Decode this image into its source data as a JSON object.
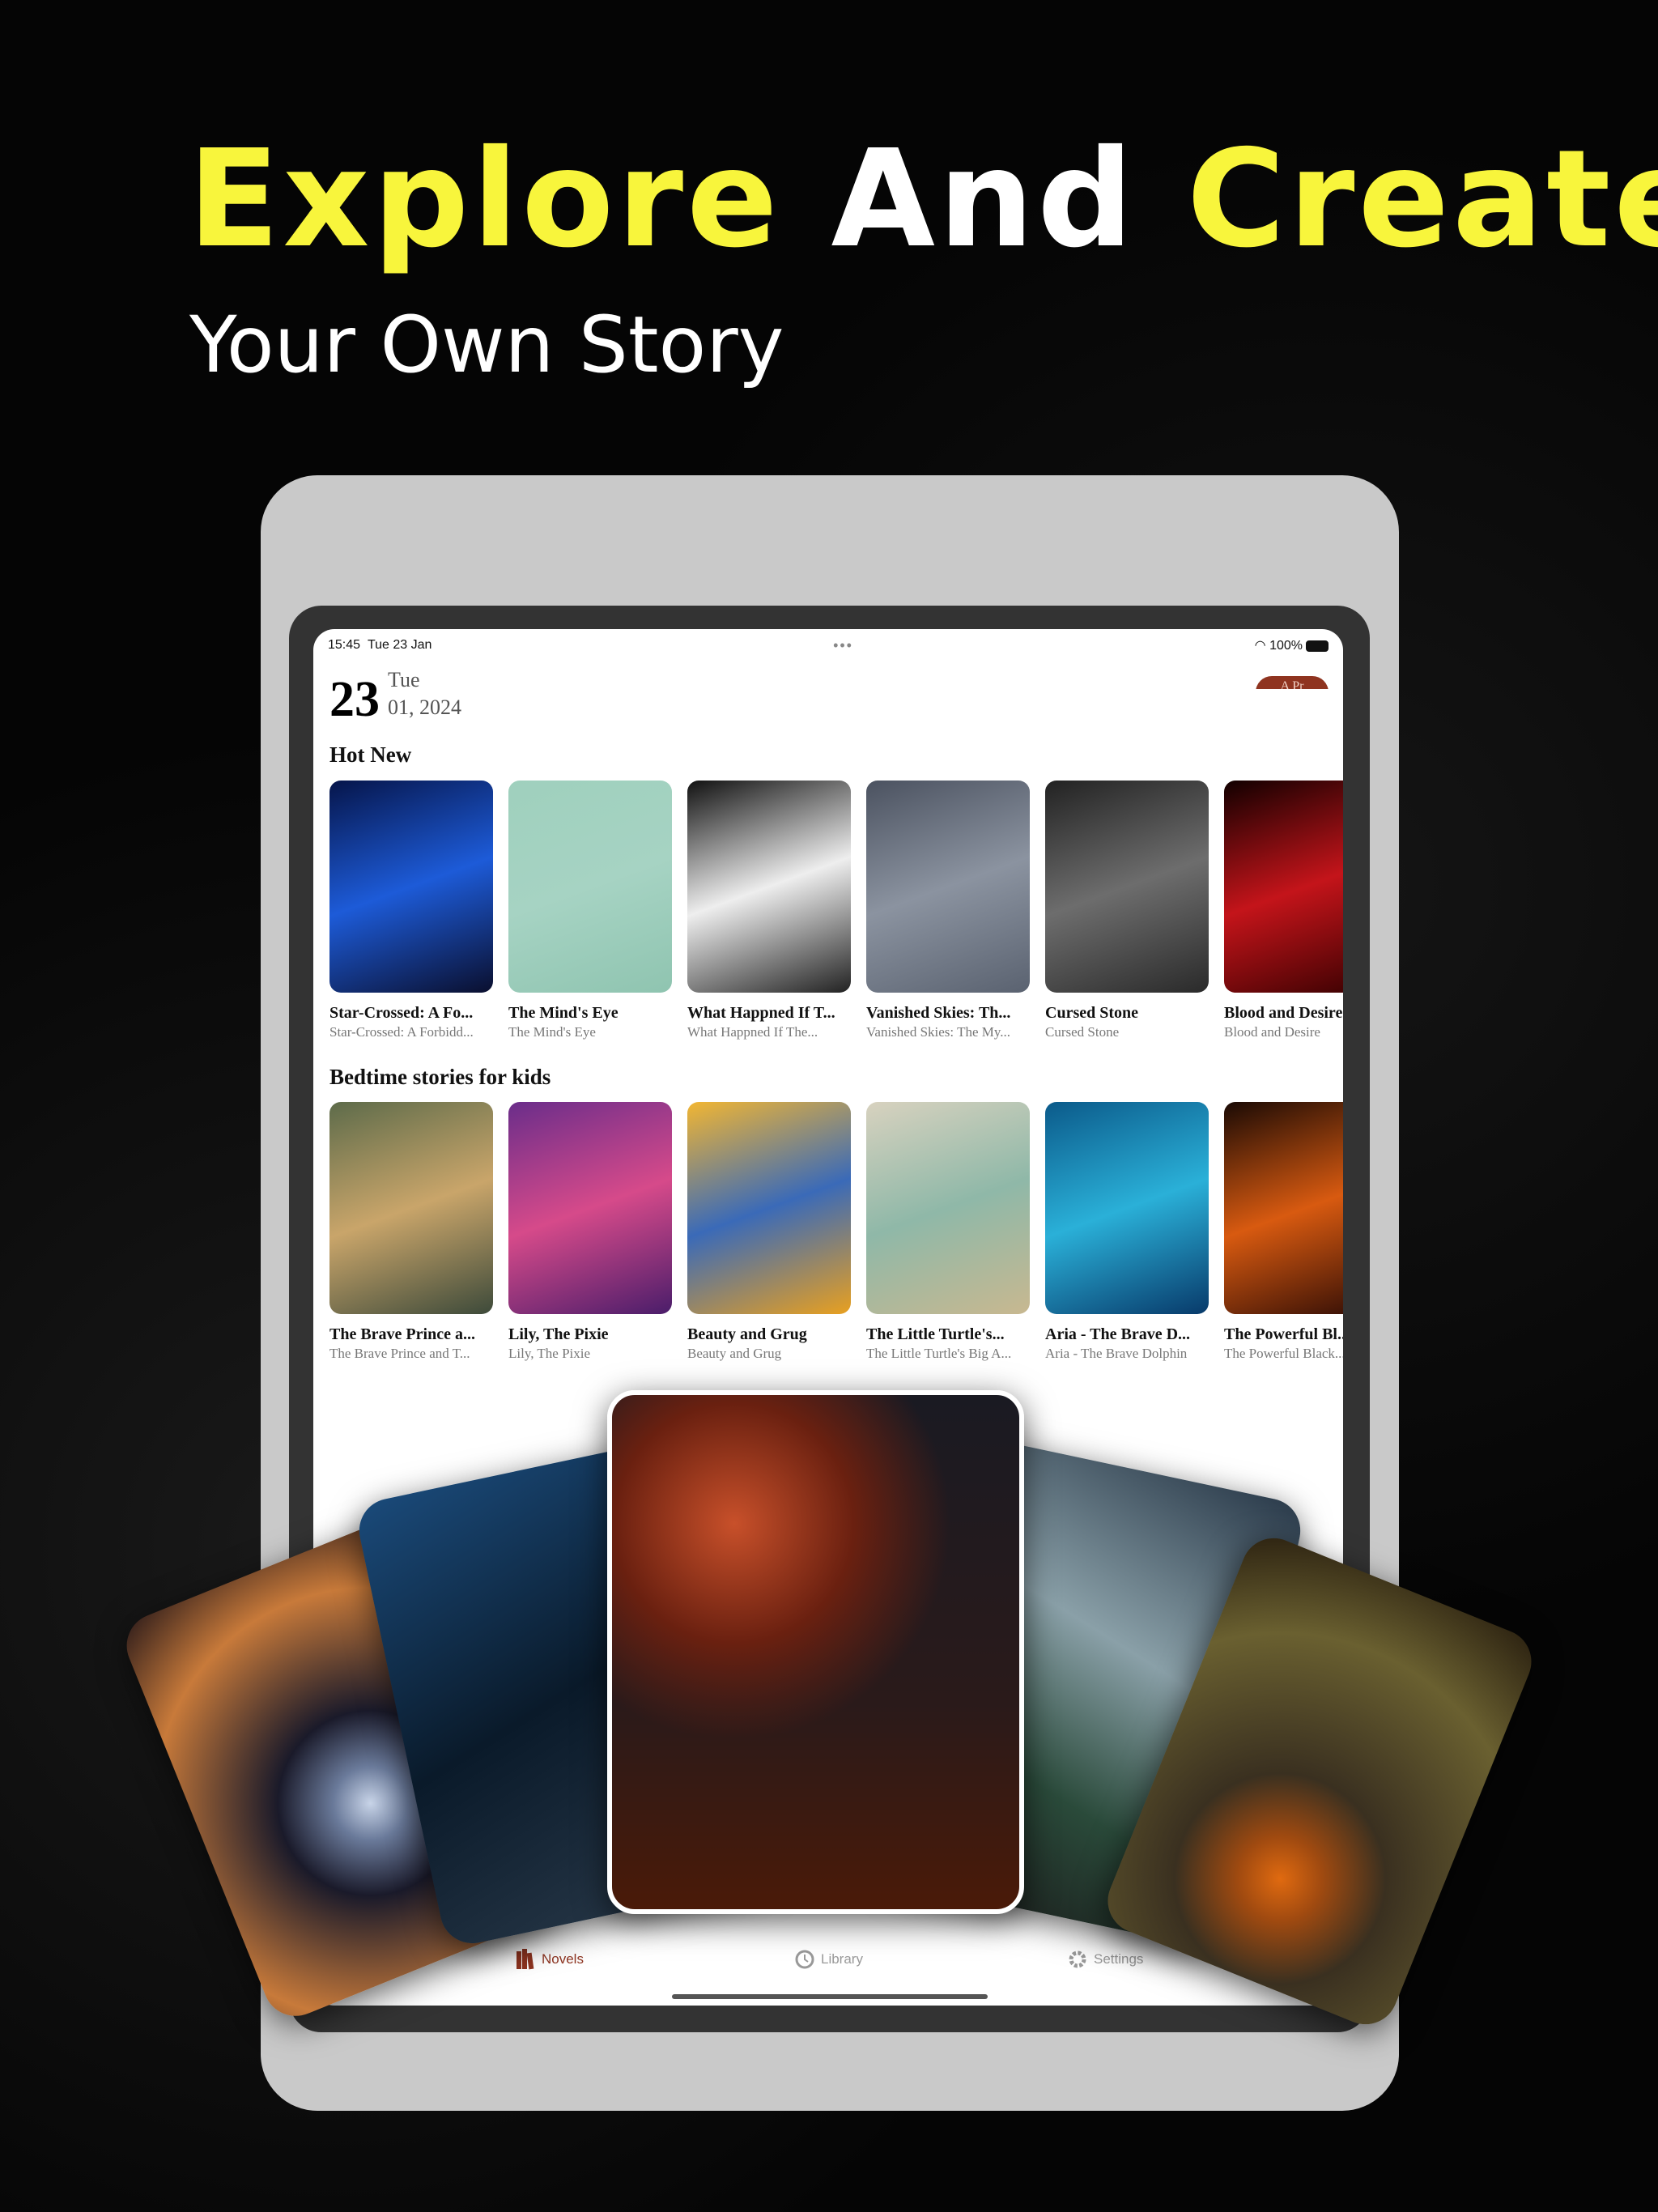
{
  "headline": {
    "part1": "Explore",
    "part2": "And",
    "part3": "Create",
    "subtitle": "Your Own Story",
    "accent": "#f8f53c"
  },
  "status": {
    "time": "15:45",
    "date": "Tue 23 Jan",
    "battery": "100%",
    "wifi_icon": "wifi-icon",
    "battery_icon": "battery-icon"
  },
  "header": {
    "day": "23",
    "weekday": "Tue",
    "month_year": "01, 2024",
    "button_label": "A Pr"
  },
  "sections": [
    {
      "title": "Hot New",
      "items": [
        {
          "title": "Star-Crossed: A Fo...",
          "subtitle": "Star-Crossed: A Forbidd...",
          "colors": [
            "#06154a",
            "#1d5bd8",
            "#0a0f2e"
          ]
        },
        {
          "title": "The Mind's Eye",
          "subtitle": "The Mind's Eye",
          "colors": [
            "#9fd0bd",
            "#a6d3c3",
            "#8fc4b0"
          ]
        },
        {
          "title": "What Happned If T...",
          "subtitle": "What Happned If The...",
          "colors": [
            "#111",
            "#eee",
            "#222"
          ]
        },
        {
          "title": "Vanished Skies: Th...",
          "subtitle": "Vanished Skies: The My...",
          "colors": [
            "#4b5260",
            "#8b93a0",
            "#5a6270"
          ]
        },
        {
          "title": "Cursed Stone",
          "subtitle": "Cursed Stone",
          "colors": [
            "#222",
            "#6d6d6d",
            "#2a2a2a"
          ]
        },
        {
          "title": "Blood and Desire",
          "subtitle": "Blood and Desire",
          "colors": [
            "#100",
            "#c4141a",
            "#300"
          ]
        }
      ]
    },
    {
      "title": "Bedtime stories for kids",
      "items": [
        {
          "title": "The Brave Prince a...",
          "subtitle": "The Brave Prince and T...",
          "colors": [
            "#5d6b4a",
            "#c9a56a",
            "#3d4a3a"
          ]
        },
        {
          "title": "Lily, The Pixie",
          "subtitle": "Lily, The Pixie",
          "colors": [
            "#6a2d8a",
            "#d64a8a",
            "#4a1d6a"
          ]
        },
        {
          "title": "Beauty and Grug",
          "subtitle": "Beauty and Grug",
          "colors": [
            "#f2b632",
            "#3a6ab8",
            "#e8a020"
          ]
        },
        {
          "title": "The Little Turtle's...",
          "subtitle": "The Little Turtle's Big A...",
          "colors": [
            "#d8d2bf",
            "#8fb8a8",
            "#c8b890"
          ]
        },
        {
          "title": "Aria - The Brave D...",
          "subtitle": "Aria - The Brave Dolphin",
          "colors": [
            "#0b5a8a",
            "#2ab0d8",
            "#083a6a"
          ]
        },
        {
          "title": "The Powerful Bl...",
          "subtitle": "The Powerful Black...",
          "colors": [
            "#1a0a05",
            "#d85a10",
            "#2a0a05"
          ]
        }
      ]
    }
  ],
  "tabs": [
    {
      "label": "Novels",
      "icon": "books-icon",
      "active": true
    },
    {
      "label": "Library",
      "icon": "clock-icon",
      "active": false
    },
    {
      "label": "Settings",
      "icon": "gear-icon",
      "active": false
    }
  ],
  "accent": "#8f3420"
}
